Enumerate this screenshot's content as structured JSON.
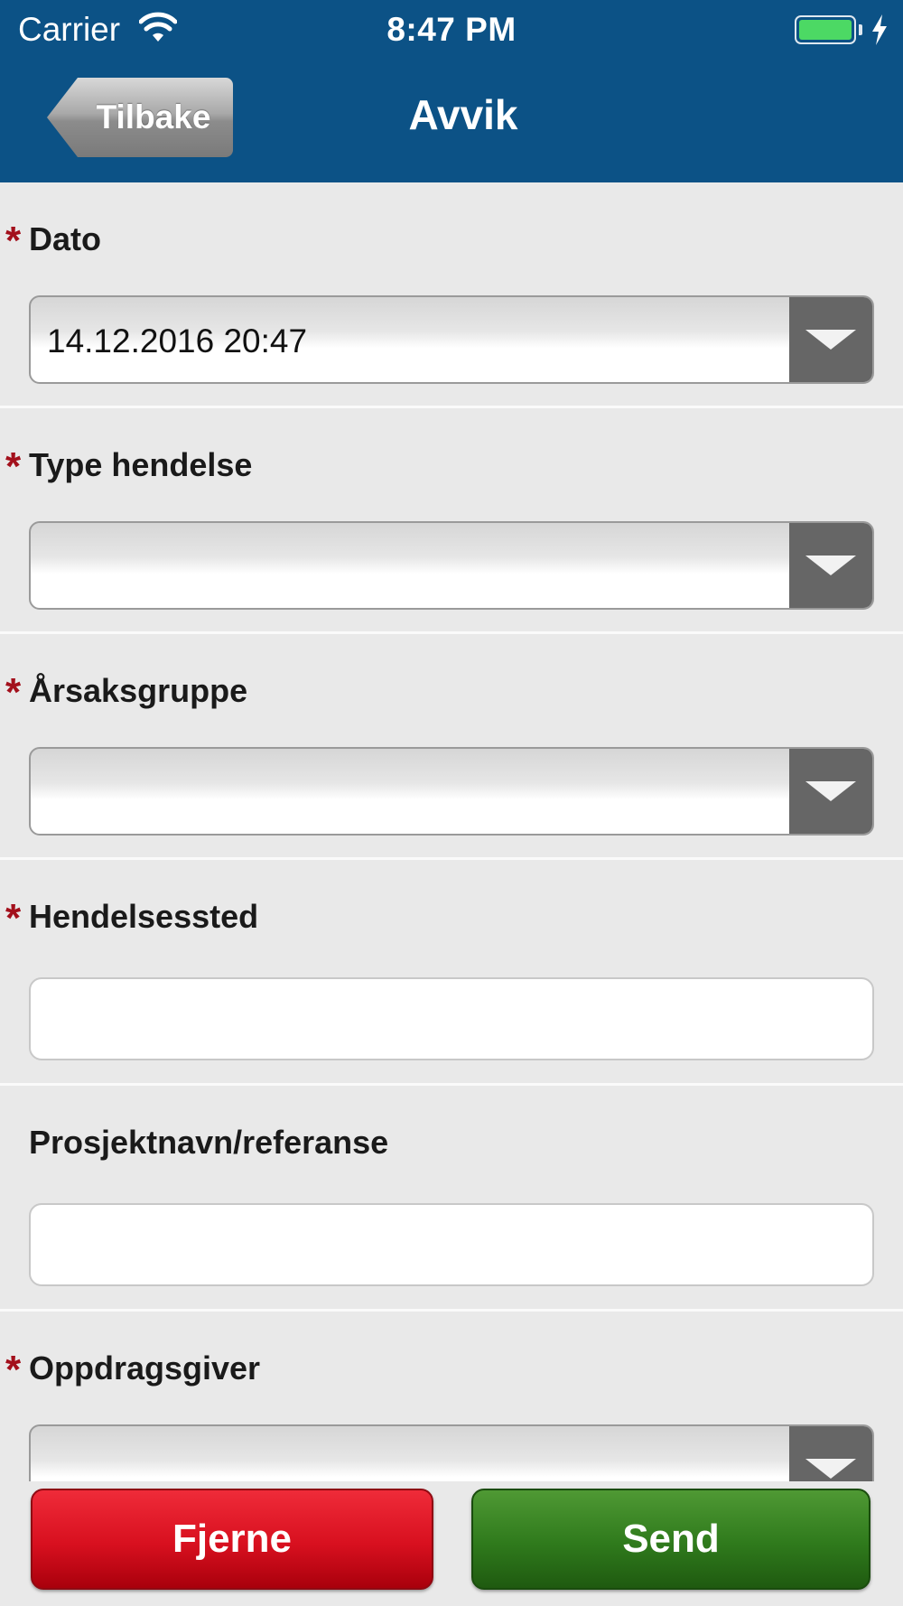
{
  "status_bar": {
    "carrier": "Carrier",
    "time": "8:47 PM",
    "battery_color": "#4cd964"
  },
  "nav": {
    "back_label": "Tilbake",
    "title": "Avvik",
    "bar_color": "#0c5286"
  },
  "form": {
    "fields": [
      {
        "label": "Dato",
        "required": true,
        "kind": "select",
        "value": "14.12.2016 20:47"
      },
      {
        "label": "Type hendelse",
        "required": true,
        "kind": "select",
        "value": ""
      },
      {
        "label": "Årsaksgruppe",
        "required": true,
        "kind": "select",
        "value": ""
      },
      {
        "label": "Hendelsessted",
        "required": true,
        "kind": "text",
        "value": ""
      },
      {
        "label": "Prosjektnavn/referanse",
        "required": false,
        "kind": "text",
        "value": ""
      },
      {
        "label": "Oppdragsgiver",
        "required": true,
        "kind": "select",
        "value": ""
      }
    ],
    "required_marker": "*",
    "required_color": "#a3101c"
  },
  "actions": {
    "remove_label": "Fjerne",
    "send_label": "Send",
    "remove_color": "#d8101f",
    "send_color": "#2f7a1c"
  }
}
